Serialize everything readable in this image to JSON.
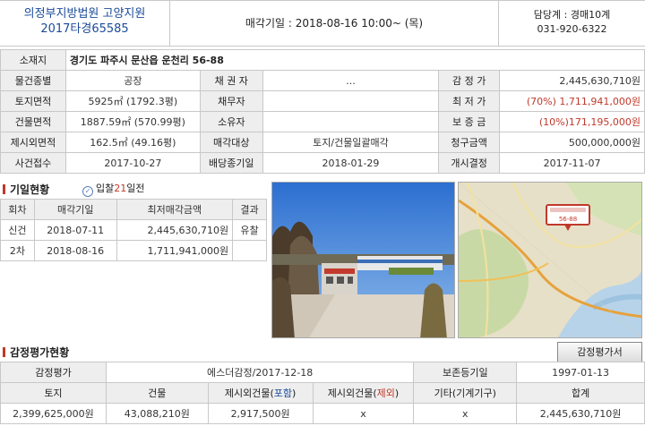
{
  "header": {
    "court_line1": "의정부지방법원 고양지원",
    "court_line2": "2017타경65585",
    "sale_date": "매각기일 : 2018-08-16   10:00~ (목)",
    "contact_line1": "담당계 : 경매10계",
    "contact_line2": "031-920-6322"
  },
  "info": {
    "address_label": "소재지",
    "address": "경기도 파주시 문산읍 운천리 56-88",
    "type_label": "물건종별",
    "type": "공장",
    "creditor_label": "채 권 자",
    "creditor": "...",
    "appraisal_label": "감 정 가",
    "appraisal": "2,445,630,710원",
    "land_label": "토지면적",
    "land": "5925㎡ (1792.3평)",
    "debtor_label": "채무자",
    "debtor": "",
    "min_price_label": "최 저 가",
    "min_price": "(70%) 1,711,941,000원",
    "building_label": "건물면적",
    "building": "1887.59㎡ (570.99평)",
    "owner_label": "소유자",
    "owner": "",
    "deposit_label": "보 증 금",
    "deposit": "(10%)171,195,000원",
    "excluded_label": "제시외면적",
    "excluded": "162.5㎡ (49.16평)",
    "sale_target_label": "매각대상",
    "sale_target": "토지/건물일괄매각",
    "claim_label": "청구금액",
    "claim": "500,000,000원",
    "case_received_label": "사건접수",
    "case_received": "2017-10-27",
    "dividend_deadline_label": "배당종기일",
    "dividend_deadline": "2018-01-29",
    "start_decision_label": "개시결정",
    "start_decision": "2017-11-07"
  },
  "history": {
    "title": "기일현황",
    "badge_prefix": "입찰",
    "badge_num": "21",
    "badge_suffix": "일전",
    "headers": [
      "회차",
      "매각기일",
      "최저매각금액",
      "결과"
    ],
    "rows": [
      {
        "round": "신건",
        "date": "2018-07-11",
        "price": "2,445,630,710원",
        "result": "유찰"
      },
      {
        "round": "2차",
        "date": "2018-08-16",
        "price": "1,711,941,000원",
        "result": ""
      }
    ]
  },
  "map_marker": "56-88",
  "appraisal": {
    "title": "감정평가현황",
    "button": "감정평가서",
    "label_appraisal": "감정평가",
    "appraiser": "에스더감정/2017-12-18",
    "preserve_label": "보존등기일",
    "preserve_date": "1997-01-13",
    "col_land": "토지",
    "col_building": "건물",
    "col_incl_pre": "제시외건물(",
    "col_incl_hl": "포함",
    "col_excl_pre": "제시외건물(",
    "col_excl_hl": "제외",
    "col_post": ")",
    "col_other": "기타(기계기구)",
    "col_total": "합계",
    "land": "2,399,625,000원",
    "building": "43,088,210원",
    "incl": "2,917,500원",
    "excl": "x",
    "other": "x",
    "total": "2,445,630,710원"
  },
  "colors": {
    "accent_red": "#c0392b",
    "accent_blue": "#1b4b9b"
  }
}
